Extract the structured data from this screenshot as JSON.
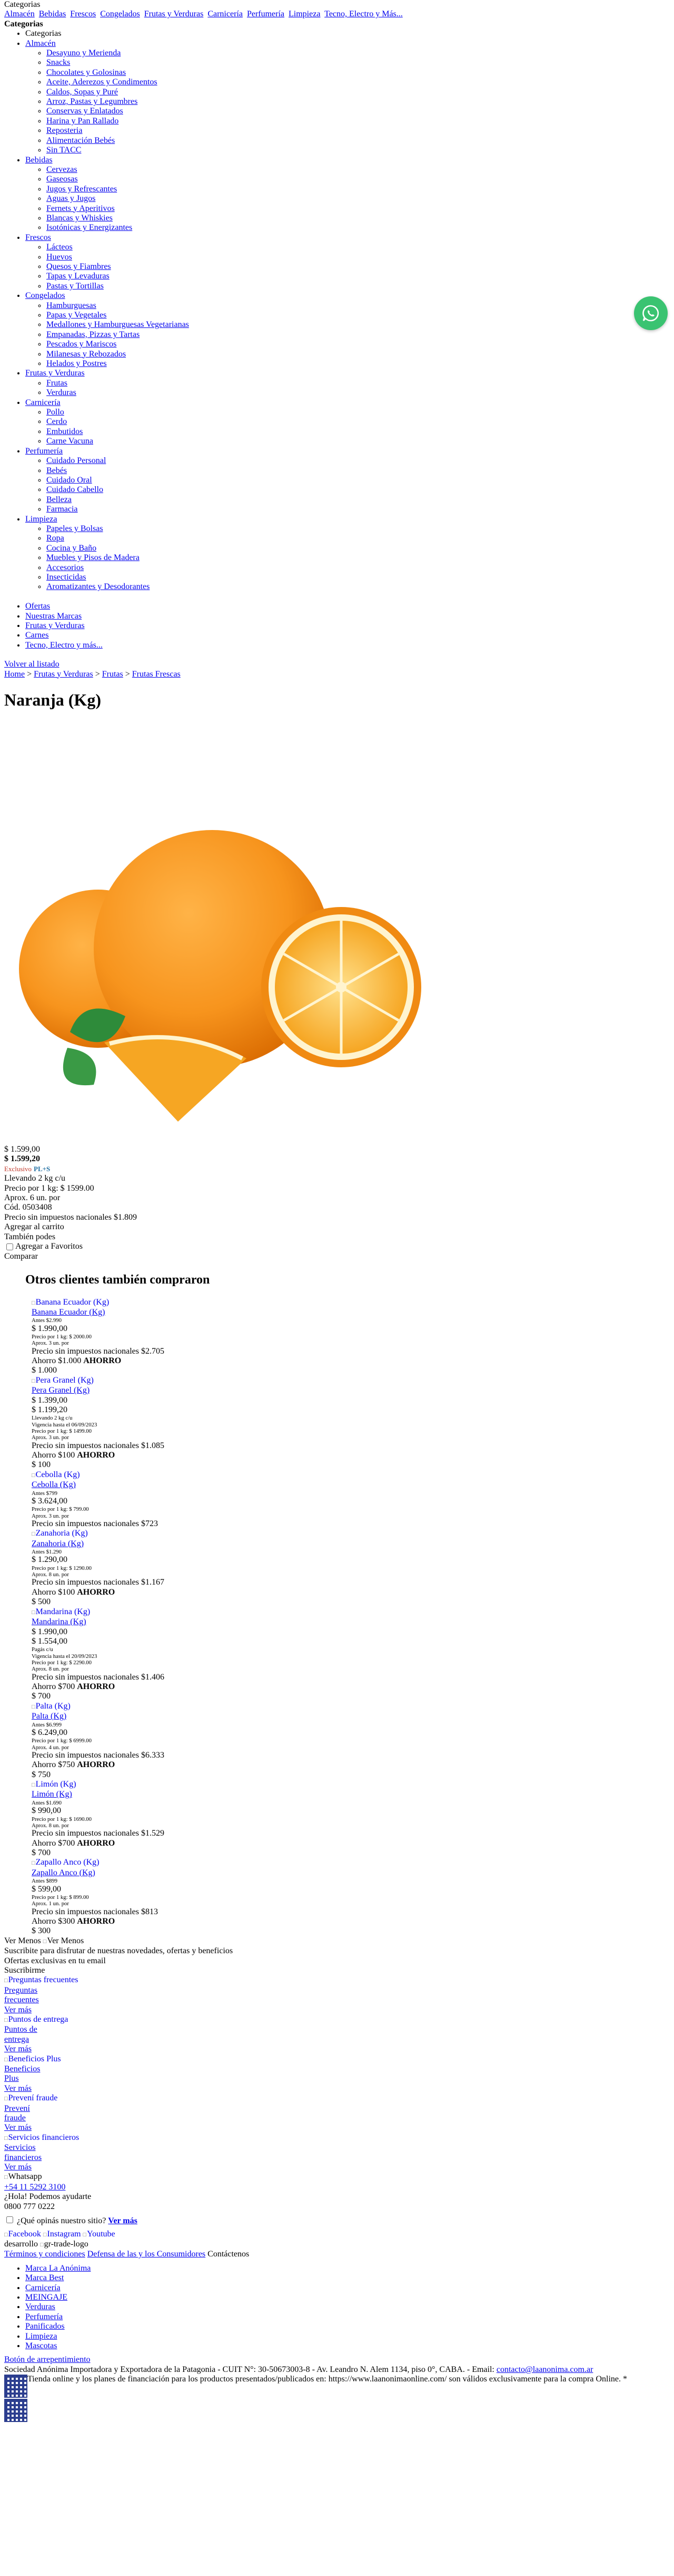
{
  "header": {
    "categories_label": "Categorias",
    "top_links": [
      "Almacén",
      "Bebidas",
      "Frescos",
      "Congelados",
      "Frutas y Verduras",
      "Carnicería",
      "Perfumería",
      "Limpieza",
      "Tecno, Electro y Más..."
    ],
    "categories_heading": "Categorias"
  },
  "menu": {
    "root_label": "Categorias",
    "groups": [
      {
        "label": "Almacén",
        "items": [
          "Desayuno y Merienda",
          "Snacks",
          "Chocolates y Golosinas",
          "Aceite, Aderezos y Condimentos",
          "Caldos, Sopas y Puré",
          "Arroz, Pastas y Legumbres",
          "Conservas y Enlatados",
          "Harina y Pan Rallado",
          "Reposteria",
          "Alimentación Bebés",
          "Sin TACC"
        ]
      },
      {
        "label": "Bebidas",
        "items": [
          "Cervezas",
          "Gaseosas",
          "Jugos y Refrescantes",
          "Aguas y Jugos",
          "Fernets y Aperitivos",
          "Blancas y Whiskies",
          "Isotónicas y Energizantes"
        ]
      },
      {
        "label": "Frescos",
        "items": [
          "Lácteos",
          "Huevos",
          "Quesos y Fiambres",
          "Tapas y Levaduras",
          "Pastas y Tortillas"
        ]
      },
      {
        "label": "Congelados",
        "items": [
          "Hamburguesas",
          "Papas y Vegetales",
          "Medallones y Hamburguesas Vegetarianas",
          "Empanadas, Pizzas y Tartas",
          "Pescados y Mariscos",
          "Milanesas y Rebozados",
          "Helados y Postres"
        ]
      },
      {
        "label": "Frutas y Verduras",
        "items": [
          "Frutas",
          "Verduras"
        ]
      },
      {
        "label": "Carnicería",
        "items": [
          "Pollo",
          "Cerdo",
          "Embutidos",
          "Carne Vacuna"
        ]
      },
      {
        "label": "Perfumería",
        "items": [
          "Cuidado Personal",
          "Bebés",
          "Cuidado Oral",
          "Cuidado Cabello",
          "Belleza",
          "Farmacia"
        ]
      },
      {
        "label": "Limpieza",
        "items": [
          "Papeles y Bolsas",
          "Ropa",
          "Cocina y Baño",
          "Muebles y Pisos de Madera",
          "Accesorios",
          "Insecticidas",
          "Aromatizantes y Desodorantes"
        ]
      }
    ],
    "extra_items": [
      "Ofertas",
      "Nuestras Marcas",
      "Frutas y Verduras",
      "Carnes",
      "Tecno, Electro y más..."
    ]
  },
  "breadcrumb": {
    "back": "Volver al listado",
    "items": [
      "Home",
      "Frutas y Verduras",
      "Frutas",
      "Frutas Frescas"
    ],
    "sep": " > "
  },
  "product": {
    "title": "Naranja (Kg)",
    "list_price": "$ 1.599,00",
    "price": "$ 1.599,20",
    "exclusive_label": "Exclusivo",
    "plus_label": "PL+S",
    "carry_text": "Llevando 2 kg c/u",
    "price_per_kg": "Precio por 1 kg: $ 1599.00",
    "approx": "Aprox. 6 un. por",
    "code": "Cód. 0503408",
    "tax_text": "Precio sin impuestos nacionales $1.809",
    "add_to_cart": "Agregar al carrito",
    "also_label": "También podes",
    "favorites": "Agregar a Favoritos",
    "compare": "Comparar"
  },
  "others": {
    "heading": "Otros clientes también compraron",
    "cards": [
      {
        "img_alt": "Banana Ecuador (Kg)",
        "name": "Banana Ecuador (Kg)",
        "tiny1": "Antes $2.990",
        "price": "$ 1.990,00",
        "tiny2": "Precio por 1 kg: $ 2000.00",
        "tiny3": "Aprox. 3 un. por",
        "tax": "Precio sin impuestos nacionales $2.705",
        "save_prefix": "Ahorro $1.000 ",
        "save_word": "AHORRO",
        "save_value": "$ 1.000"
      },
      {
        "img_alt": "Pera Granel (Kg)",
        "name": "Pera Granel (Kg)",
        "tiny1": "",
        "price": "$ 1.399,00",
        "price2": "$ 1.199,20",
        "tiny2": "Llevando 2 kg c/u",
        "tiny3": "Vigencia hasta el 06/09/2023",
        "tiny4": "Precio por 1 kg: $ 1499.00",
        "tiny5": "Aprox. 3 un. por",
        "tax": "Precio sin impuestos nacionales $1.085",
        "save_prefix": "Ahorro $100 ",
        "save_word": "AHORRO",
        "save_value": "$ 100"
      },
      {
        "img_alt": "Cebolla (Kg)",
        "name": "Cebolla (Kg)",
        "tiny1": "Antes $799",
        "price": "$ 3.624,00",
        "tiny2": "Precio por 1 kg: $ 799.00",
        "tiny3": "Aprox. 3 un. por",
        "tax": "Precio sin impuestos nacionales $723",
        "save_prefix": "",
        "save_word": "",
        "save_value": ""
      },
      {
        "img_alt": "Zanahoria (Kg)",
        "name": "Zanahoria (Kg)",
        "tiny1": "Antes $1.290",
        "price": "$ 1.290,00",
        "tiny2": "Precio por 1 kg: $ 1290.00",
        "tiny3": "Aprox. 8 un. por",
        "tax": "Precio sin impuestos nacionales $1.167",
        "save_prefix": "Ahorro $100 ",
        "save_word": "AHORRO",
        "save_value": "$ 500"
      },
      {
        "img_alt": "Mandarina (Kg)",
        "name": "Mandarina (Kg)",
        "tiny1": "",
        "price": "$ 1.990,00",
        "price2": "$ 1.554,00",
        "tiny2": "Pagás c/u",
        "tiny3": "Vigencia hasta el 20/09/2023",
        "tiny4": "Precio por 1 kg: $ 2290.00",
        "tiny5": "Aprox. 8 un. por",
        "tax": "Precio sin impuestos nacionales $1.406",
        "save_prefix": "Ahorro $700 ",
        "save_word": "AHORRO",
        "save_value": "$ 700"
      },
      {
        "img_alt": "Palta (Kg)",
        "name": "Palta (Kg)",
        "tiny1": "Antes $6.999",
        "price": "$ 6.249,00",
        "tiny2": "Precio por 1 kg: $ 6999.00",
        "tiny3": "Aprox. 4 un. por",
        "tax": "Precio sin impuestos nacionales $6.333",
        "save_prefix": "Ahorro $750 ",
        "save_word": "AHORRO",
        "save_value": "$ 750"
      },
      {
        "img_alt": "Limón (Kg)",
        "name": "Limón (Kg)",
        "tiny1": "Antes $1.690",
        "price": "$ 990,00",
        "tiny2": "Precio por 1 kg: $ 1690.00",
        "tiny3": "Aprox. 8 un. por",
        "tax": "Precio sin impuestos nacionales $1.529",
        "save_prefix": "Ahorro $700 ",
        "save_word": "AHORRO",
        "save_value": "$ 700"
      },
      {
        "img_alt": "Zapallo Anco (Kg)",
        "name": "Zapallo Anco (Kg)",
        "tiny1": "Antes $899",
        "price": "$ 599,00",
        "tiny2": "Precio por 1 kg: $ 899.00",
        "tiny3": "Aprox. 1 un. por",
        "tax": "Precio sin impuestos nacionales $813",
        "save_prefix": "Ahorro $300 ",
        "save_word": "AHORRO",
        "save_value": "$ 300"
      }
    ],
    "see_less": "Ver Menos"
  },
  "newsletter": {
    "line1": "Suscribite para disfrutar de nuestras novedades, ofertas y beneficios",
    "line2": "Ofertas exclusivas en tu email",
    "button": "Suscribirme"
  },
  "info_links": [
    {
      "alt": "Preguntas frecuentes",
      "lines": [
        "Preguntas",
        "frecuentes"
      ],
      "more": "Ver más"
    },
    {
      "alt": "Puntos de entrega",
      "lines": [
        "Puntos de",
        "entrega"
      ],
      "more": "Ver más"
    },
    {
      "alt": "Beneficios Plus",
      "lines": [
        "Beneficios",
        "Plus"
      ],
      "more": "Ver más"
    },
    {
      "alt": "Prevení fraude",
      "lines": [
        "Prevení",
        "fraude"
      ],
      "more": "Ver más"
    },
    {
      "alt": "Servicios financieros",
      "lines": [
        "Servicios",
        "financieros"
      ],
      "more": "Ver más"
    }
  ],
  "contact": {
    "whatsapp_alt": "Whatsapp",
    "phone": "+54 11 5292 3100",
    "help": "¿Hola! Podemos ayudarte",
    "hotline": "0800 777 0222",
    "survey": "¿Qué opinás nuestro sitio?",
    "survey_link": "Ver más",
    "socials": [
      "Facebook",
      "Instagram",
      "Youtube"
    ],
    "dev_label": "desarrollo",
    "dev_img_alt": "gr-trade-logo",
    "terms": "Términos y condiciones",
    "consumer": "Defensa de las y los Consumidores",
    "contact_link": "Contáctenos"
  },
  "footer_menu": [
    "Marca La Anónima",
    "Marca Best",
    "Carnicería",
    "MEINGAJE",
    "Verduras",
    "Perfumería",
    "Panificados",
    "Limpieza",
    "Mascotas"
  ],
  "footer_text": {
    "regret": "Botón de arrepentimiento",
    "legal": "Sociedad Anónima Importadora y Exportadora de la Patagonia - CUIT N°: 30-50673003-8 - Av. Leandro N. Alem 1134, piso 0°, CABA. - Email: ",
    "email": "contacto@laanonima.com.ar",
    "promo": "Tienda online y los planes de financiación para los productos presentados/publicados en: https://www.laanonimaonline.com/ son válidos exclusivamente para la compra Online. *"
  },
  "colors": {
    "whatsapp_green": "#3ac371",
    "link_blue": "#0000ee",
    "exclusive_red": "#c0392b",
    "plus_blue": "#2471a3"
  }
}
